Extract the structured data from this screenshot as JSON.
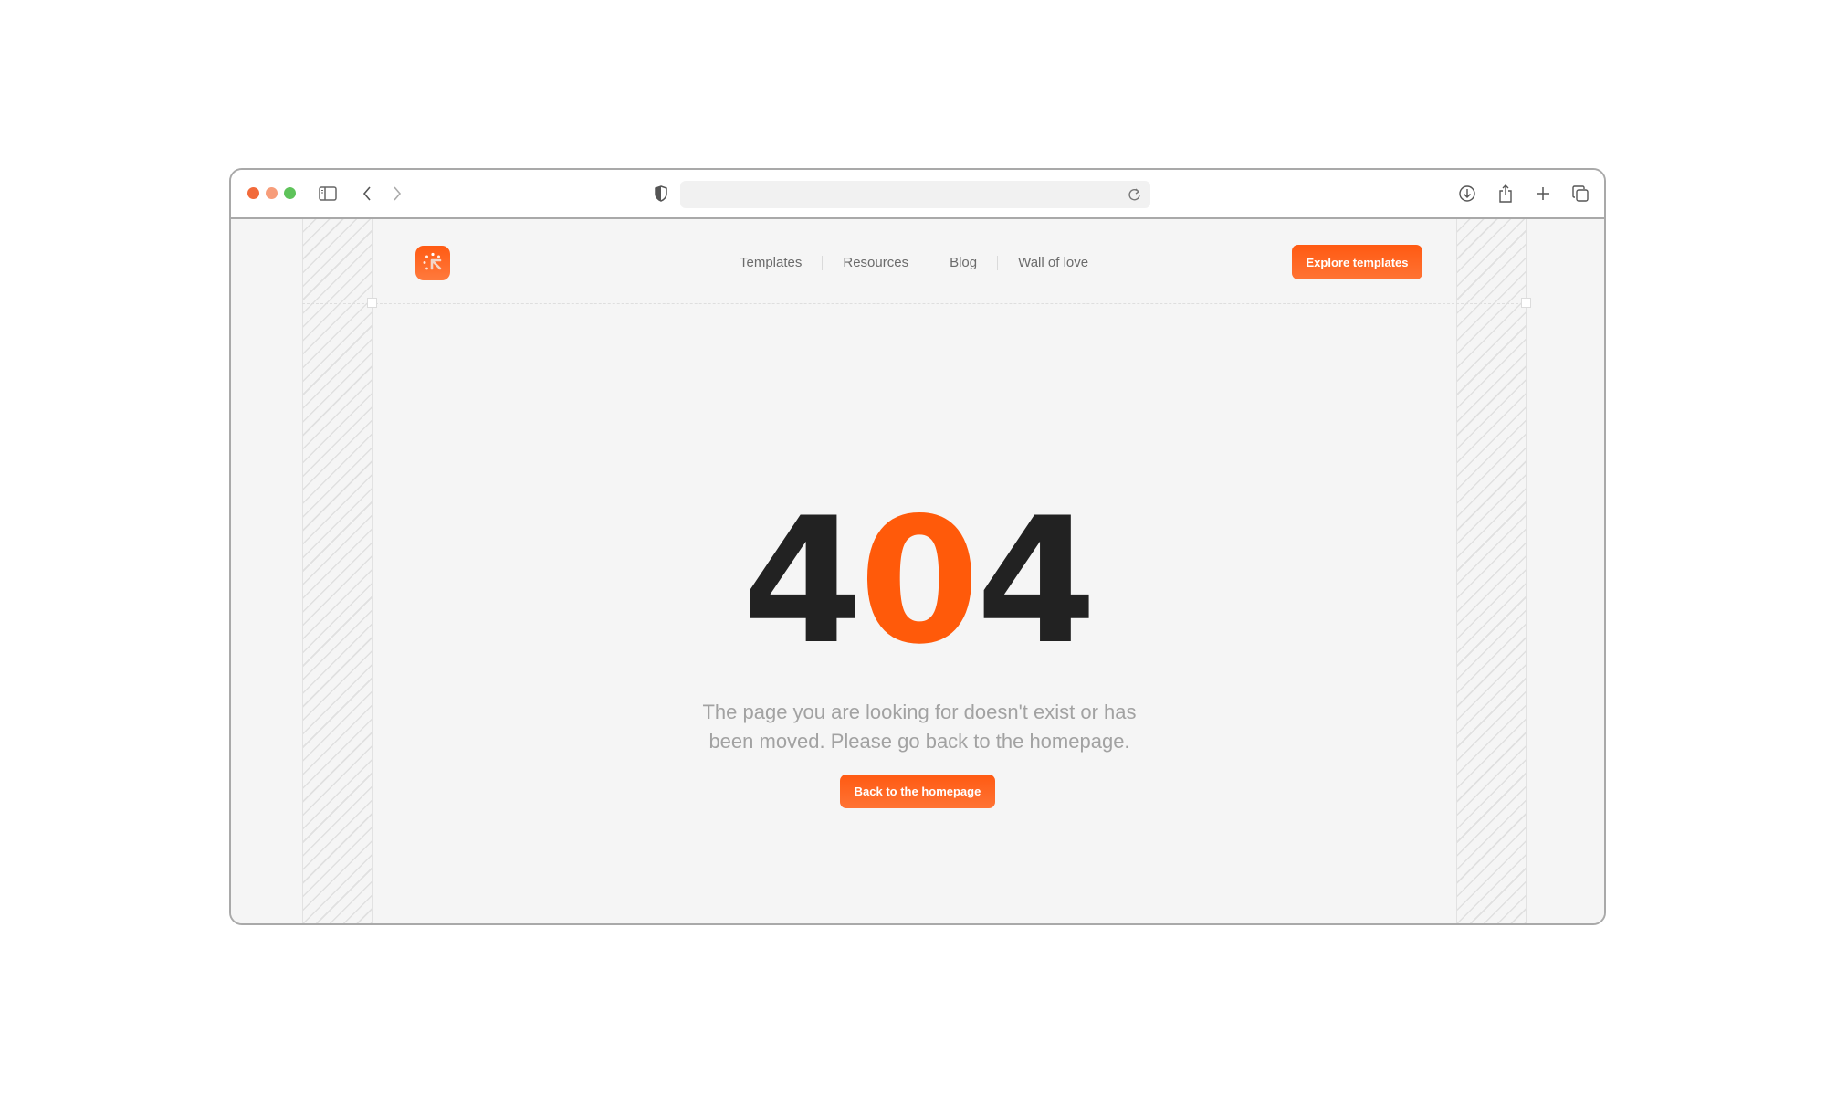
{
  "browser": {
    "traffic_lights": [
      "close",
      "minimize",
      "zoom"
    ],
    "toolbar_icons": [
      "sidebar-toggle-icon",
      "back-icon",
      "forward-icon",
      "shield-icon",
      "reload-icon",
      "download-icon",
      "share-icon",
      "new-tab-icon",
      "tabs-overview-icon"
    ],
    "url": ""
  },
  "site": {
    "accent_color": "#ff5a0a",
    "nav": [
      {
        "label": "Templates"
      },
      {
        "label": "Resources"
      },
      {
        "label": "Blog"
      },
      {
        "label": "Wall of love"
      }
    ],
    "cta_label": "Explore templates"
  },
  "error": {
    "code_parts": [
      "4",
      "0",
      "4"
    ],
    "message": "The page you are looking for doesn't exist or has been moved. Please go back to the homepage.",
    "button_label": "Back to the homepage"
  }
}
